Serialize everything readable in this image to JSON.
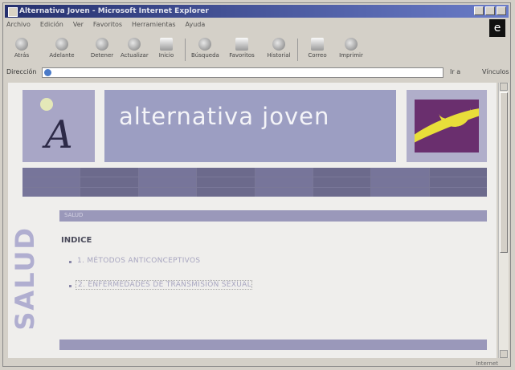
{
  "window": {
    "title": "Alternativa Joven - Microsoft Internet Explorer"
  },
  "menu": {
    "items": [
      {
        "label": "Archivo"
      },
      {
        "label": "Edición"
      },
      {
        "label": "Ver"
      },
      {
        "label": "Favoritos"
      },
      {
        "label": "Herramientas"
      },
      {
        "label": "Ayuda"
      }
    ]
  },
  "toolbar": {
    "buttons": [
      {
        "label": "Atrás",
        "icon": "back-icon"
      },
      {
        "label": "Adelante",
        "icon": "forward-icon"
      },
      {
        "label": "Detener",
        "icon": "stop-icon"
      },
      {
        "label": "Actualizar",
        "icon": "refresh-icon"
      },
      {
        "label": "Inicio",
        "icon": "home-icon"
      },
      {
        "label": "Búsqueda",
        "icon": "search-icon"
      },
      {
        "label": "Favoritos",
        "icon": "favorites-icon"
      },
      {
        "label": "Historial",
        "icon": "history-icon"
      },
      {
        "label": "Correo",
        "icon": "mail-icon"
      },
      {
        "label": "Imprimir",
        "icon": "print-icon"
      }
    ]
  },
  "address": {
    "label": "Dirección",
    "go_label": "Ir a",
    "links_label": "Vínculos"
  },
  "page": {
    "banner_title": "alternativa joven",
    "section_label": "SALUD",
    "side_word": "SALUD",
    "index_title": "INDICE",
    "index_items": [
      {
        "label": "1. MÉTODOS ANTICONCEPTIVOS"
      },
      {
        "label": "2. ENFERMEDADES DE TRANSMISIÓN SEXUAL"
      }
    ]
  },
  "status": {
    "zone": "Internet"
  },
  "colors": {
    "accent": "#9a98ba",
    "banner": "#9c9ec2",
    "nav": "#6c6a8c",
    "logo_purple": "#6a2f6e",
    "logo_yellow": "#e8de3a"
  }
}
